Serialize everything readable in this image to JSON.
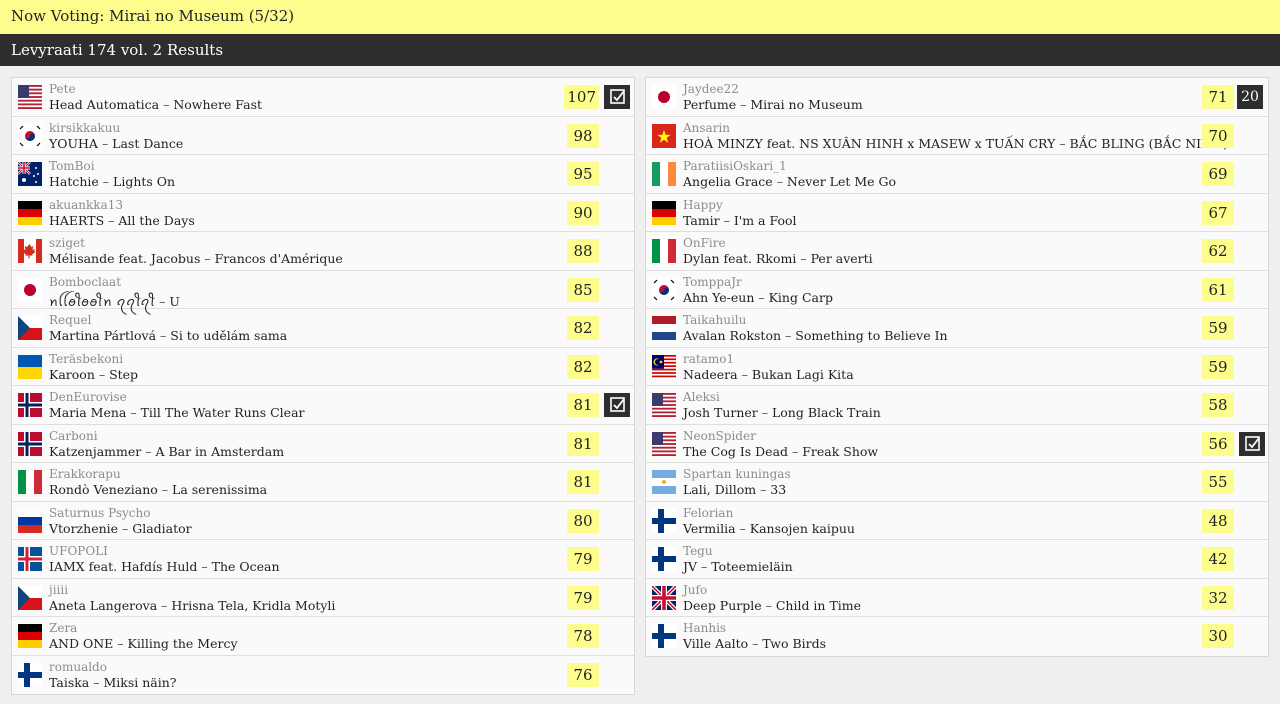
{
  "topbar": {
    "text": "Now Voting: Mirai no Museum (5/32)"
  },
  "header": {
    "title": "Levyraati 174 vol. 2 Results"
  },
  "left": [
    {
      "user": "Pete",
      "artist": "Head Automatica",
      "title": "Nowhere Fast",
      "score": "107",
      "flag": "us",
      "check": true
    },
    {
      "user": "kirsikkakuu",
      "artist": "YOUHA",
      "title": "Last Dance",
      "score": "98",
      "flag": "kr"
    },
    {
      "user": "TomBoi",
      "artist": "Hatchie",
      "title": "Lights On",
      "score": "95",
      "flag": "au"
    },
    {
      "user": "akuankka13",
      "artist": "HAERTS",
      "title": "All the Days",
      "score": "90",
      "flag": "de"
    },
    {
      "user": "sziget",
      "artist": "Mélisande feat. Jacobus",
      "title": "Francos d'Amérique",
      "score": "88",
      "flag": "ca"
    },
    {
      "user": "Bomboclaat",
      "artist": "ꪀꪶꪶꪮꪻꪮꪮꪻꪀ ꪖꪖꪻꪖꪻ",
      "title": "U",
      "score": "85",
      "flag": "jp"
    },
    {
      "user": "Requel",
      "artist": "Martina Pártlová",
      "title": "Si to udělám sama",
      "score": "82",
      "flag": "cz"
    },
    {
      "user": "Teräsbekoni",
      "artist": "Karoon",
      "title": "Step",
      "score": "82",
      "flag": "ua"
    },
    {
      "user": "DenEurovise",
      "artist": "Maria Mena",
      "title": "Till The Water Runs Clear",
      "score": "81",
      "flag": "no",
      "check": true
    },
    {
      "user": "Carboni",
      "artist": "Katzenjammer",
      "title": "A Bar in Amsterdam",
      "score": "81",
      "flag": "no"
    },
    {
      "user": "Erakkorapu",
      "artist": "Rondò Veneziano",
      "title": "La serenissima",
      "score": "81",
      "flag": "it"
    },
    {
      "user": "Saturnus Psycho",
      "artist": "Vtorzhenie",
      "title": "Gladiator",
      "score": "80",
      "flag": "ru"
    },
    {
      "user": "UFOPOLI",
      "artist": "IAMX feat. Hafdís Huld",
      "title": "The Ocean",
      "score": "79",
      "flag": "is"
    },
    {
      "user": "jiiii",
      "artist": "Aneta Langerova",
      "title": "Hrisna Tela, Kridla Motyli",
      "score": "79",
      "flag": "cz"
    },
    {
      "user": "Zera",
      "artist": "AND ONE",
      "title": "Killing the Mercy",
      "score": "78",
      "flag": "de"
    },
    {
      "user": "romualdo",
      "artist": "Taiska",
      "title": "Miksi näin?",
      "score": "76",
      "flag": "fi"
    }
  ],
  "right": [
    {
      "user": "Jaydee22",
      "artist": "Perfume",
      "title": "Mirai no Museum",
      "score": "71",
      "flag": "jp",
      "points": "20"
    },
    {
      "user": "Ansarin",
      "artist": "HOÀ MINZY feat. NS XUÂN HINH x MASEW x TUẤN CRY",
      "title": "BẮC BLING (BẮC NINH)",
      "score": "70",
      "flag": "vn"
    },
    {
      "user": "ParatiisiOskari_1",
      "artist": "Angelia Grace",
      "title": "Never Let Me Go",
      "score": "69",
      "flag": "ie"
    },
    {
      "user": "Happy",
      "artist": "Tamir",
      "title": "I'm a Fool",
      "score": "67",
      "flag": "de"
    },
    {
      "user": "OnFire",
      "artist": "Dylan feat. Rkomi",
      "title": "Per averti",
      "score": "62",
      "flag": "it"
    },
    {
      "user": "TomppaJr",
      "artist": "Ahn Ye-eun",
      "title": "King Carp",
      "score": "61",
      "flag": "kr"
    },
    {
      "user": "Taikahuilu",
      "artist": "Avalan Rokston",
      "title": "Something to Believe In",
      "score": "59",
      "flag": "nl"
    },
    {
      "user": "ratamo1",
      "artist": "Nadeera",
      "title": "Bukan Lagi Kita",
      "score": "59",
      "flag": "my"
    },
    {
      "user": "Aleksi",
      "artist": "Josh Turner",
      "title": "Long Black Train",
      "score": "58",
      "flag": "us"
    },
    {
      "user": "NeonSpider",
      "artist": "The Cog Is Dead",
      "title": "Freak Show",
      "score": "56",
      "flag": "us",
      "check": true
    },
    {
      "user": "Spartan kuningas",
      "artist": "Lali, Dillom",
      "title": "33",
      "score": "55",
      "flag": "ar"
    },
    {
      "user": "Felorian",
      "artist": "Vermilia",
      "title": "Kansojen kaipuu",
      "score": "48",
      "flag": "fi"
    },
    {
      "user": "Tegu",
      "artist": "JV",
      "title": "Toteemieläin",
      "score": "42",
      "flag": "fi"
    },
    {
      "user": "Jufo",
      "artist": "Deep Purple",
      "title": "Child in Time",
      "score": "32",
      "flag": "gb"
    },
    {
      "user": "Hanhis",
      "artist": "Ville Aalto",
      "title": "Two Birds",
      "score": "30",
      "flag": "fi"
    }
  ]
}
